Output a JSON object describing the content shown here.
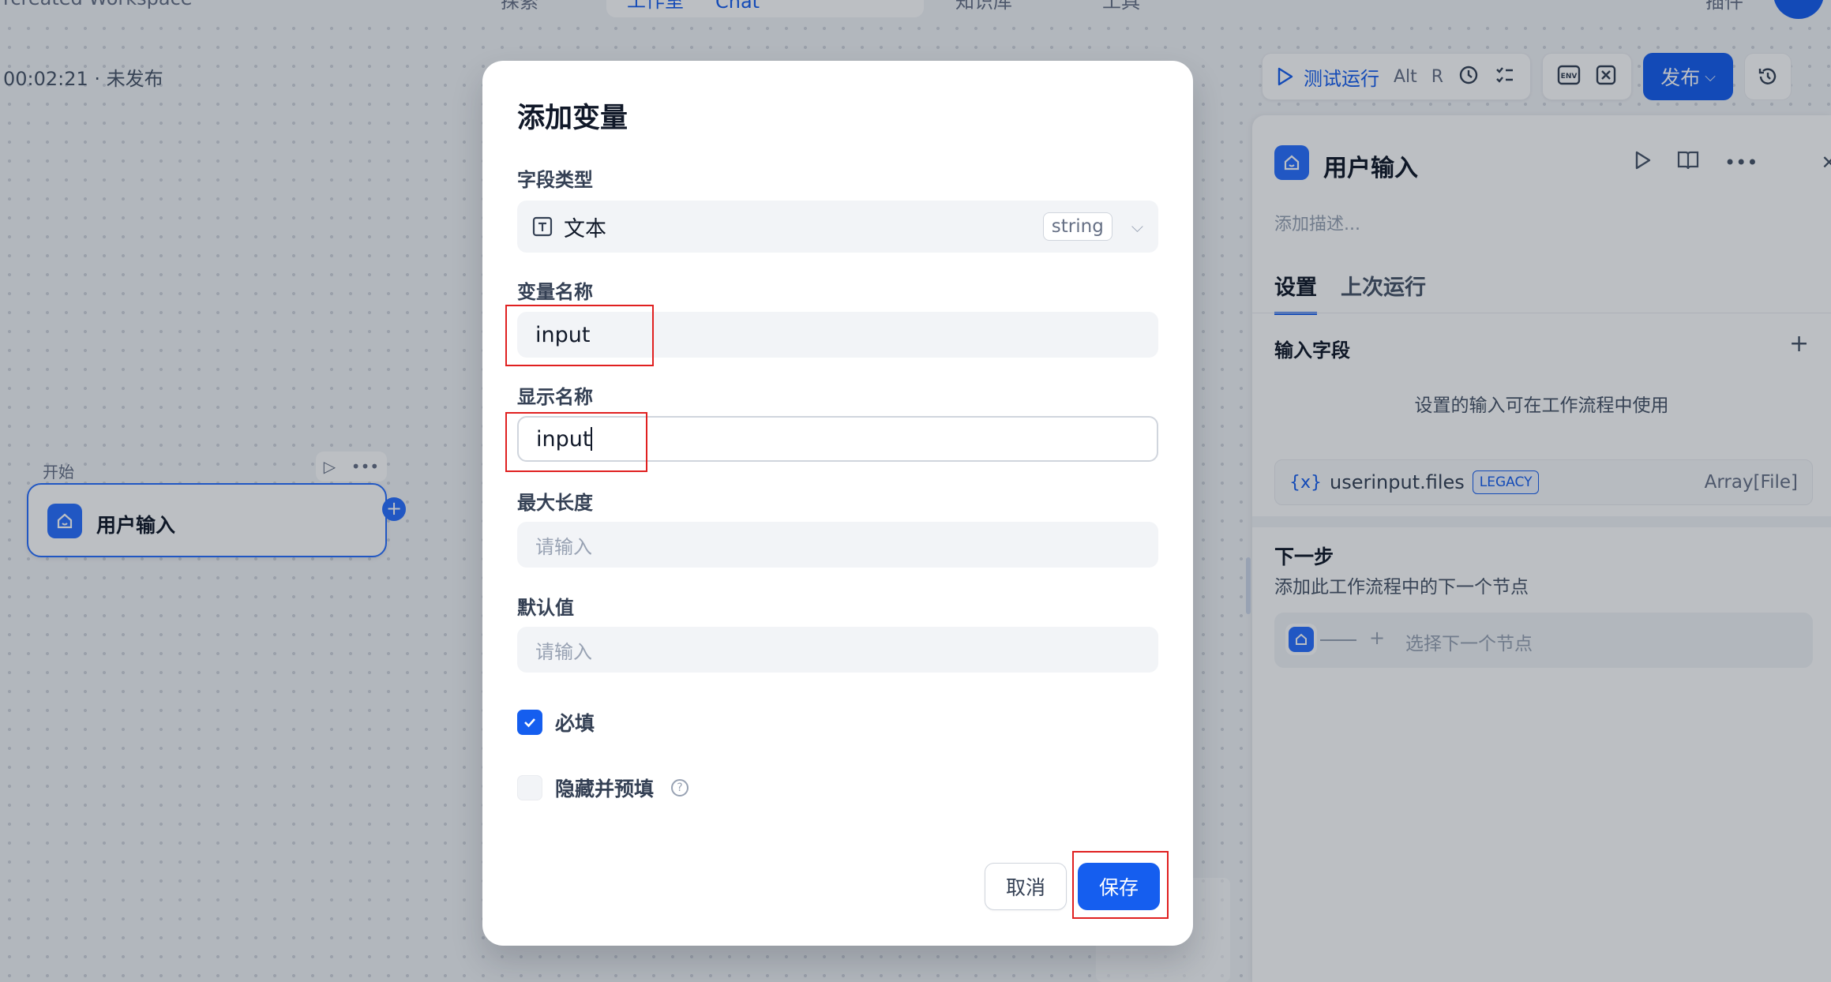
{
  "background": {
    "workspace_title": "rcreated Workspace",
    "nav": [
      "探索",
      "工作室",
      "Chat",
      "知识库",
      "工具",
      "插件"
    ],
    "status": "00:02:21 · 未发布",
    "start_node": {
      "section_label": "开始",
      "title": "用户输入"
    }
  },
  "toolbar": {
    "run_label": "测试运行",
    "shortcut_alt": "Alt",
    "shortcut_r": "R",
    "env_label": "ENV",
    "publish_label": "发布"
  },
  "panel": {
    "title": "用户输入",
    "description_placeholder": "添加描述...",
    "tabs": [
      "设置",
      "上次运行"
    ],
    "input_fields_title": "输入字段",
    "input_fields_hint": "设置的输入可在工作流程中使用",
    "variable": {
      "name": "userinput.files",
      "badge": "LEGACY",
      "type": "Array[File]"
    },
    "next_step_title": "下一步",
    "next_step_desc": "添加此工作流程中的下一个节点",
    "next_node_placeholder": "选择下一个节点"
  },
  "modal": {
    "title": "添加变量",
    "field_type_label": "字段类型",
    "field_type_value": "文本",
    "field_type_tag": "string",
    "var_name_label": "变量名称",
    "var_name_value": "input",
    "display_name_label": "显示名称",
    "display_name_value": "input",
    "max_length_label": "最大长度",
    "max_length_placeholder": "请输入",
    "default_label": "默认值",
    "default_placeholder": "请输入",
    "required_label": "必填",
    "required_checked": true,
    "hidden_label": "隐藏并预填",
    "hidden_checked": false,
    "cancel_label": "取消",
    "save_label": "保存"
  },
  "colors": {
    "accent": "#155eef",
    "annotation": "#e02020"
  }
}
